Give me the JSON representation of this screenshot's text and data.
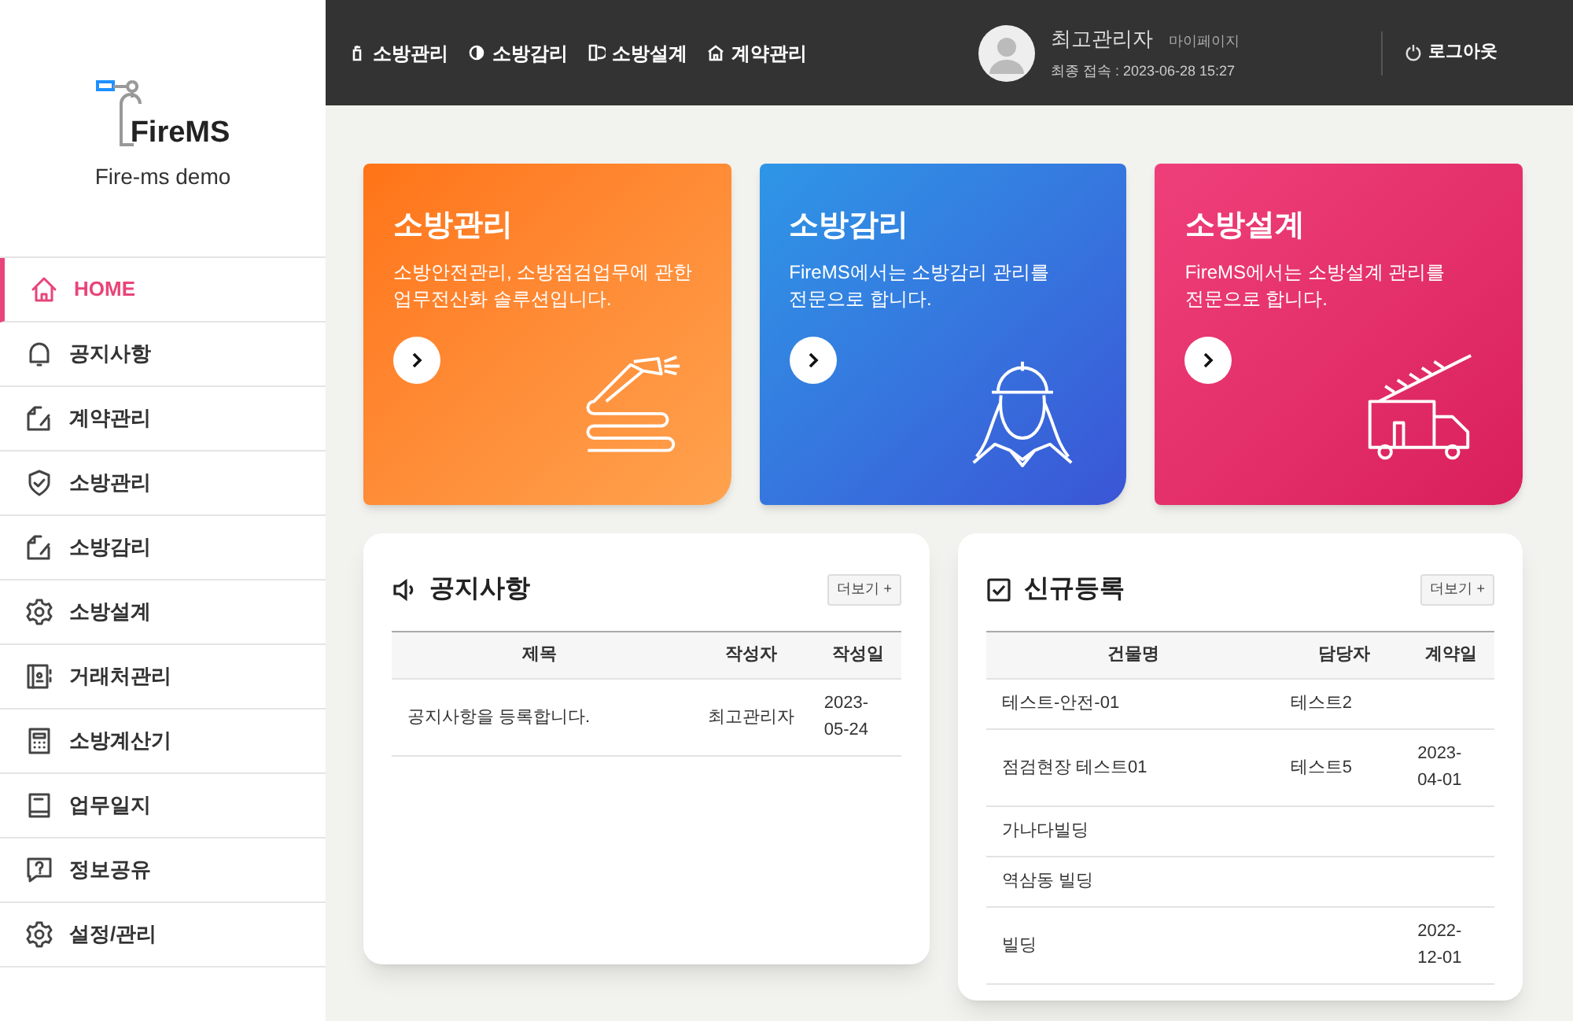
{
  "logo": {
    "name": "FireMS",
    "subtitle": "Fire-ms demo"
  },
  "sidebar": {
    "items": [
      {
        "label": "HOME",
        "kind": "home",
        "selected": true
      },
      {
        "label": "공지사항",
        "kind": "bell",
        "selected": false
      },
      {
        "label": "계약관리",
        "kind": "edit",
        "selected": false
      },
      {
        "label": "소방관리",
        "kind": "shield",
        "selected": false
      },
      {
        "label": "소방감리",
        "kind": "edit",
        "selected": false
      },
      {
        "label": "소방설계",
        "kind": "gear",
        "selected": false
      },
      {
        "label": "거래처관리",
        "kind": "contacts",
        "selected": false
      },
      {
        "label": "소방계산기",
        "kind": "calculator",
        "selected": false
      },
      {
        "label": "업무일지",
        "kind": "book",
        "selected": false
      },
      {
        "label": "정보공유",
        "kind": "question",
        "selected": false
      },
      {
        "label": "설정/관리",
        "kind": "gear",
        "selected": false
      }
    ]
  },
  "top_nav": [
    {
      "label": "소방관리",
      "kind": "extinguisher"
    },
    {
      "label": "소방감리",
      "kind": "contrast"
    },
    {
      "label": "소방설계",
      "kind": "design"
    },
    {
      "label": "계약관리",
      "kind": "contract"
    }
  ],
  "user": {
    "name": "최고관리자",
    "mypage": "마이페이지",
    "last_login": "최종 접속 : 2023-06-28 15:27",
    "logout": "로그아웃"
  },
  "cards": [
    {
      "title": "소방관리",
      "description": "소방안전관리, 소방점검업무에 관한\n업무전산화 솔루션입니다.",
      "kind": "hose"
    },
    {
      "title": "소방감리",
      "description": "FireMS에서는 소방감리 관리를\n전문으로 합니다.",
      "kind": "worker"
    },
    {
      "title": "소방설계",
      "description": "FireMS에서는 소방설계 관리를\n전문으로 합니다.",
      "kind": "truck"
    }
  ],
  "notice": {
    "title": "공지사항",
    "more": "더보기 +",
    "columns": [
      "제목",
      "작성자",
      "작성일"
    ],
    "rows": [
      [
        "공지사항을 등록합니다.",
        "최고관리자",
        "2023-\n05-24"
      ]
    ]
  },
  "new_registrations": {
    "title": "신규등록",
    "more": "더보기 +",
    "columns": [
      "건물명",
      "담당자",
      "계약일"
    ],
    "rows": [
      [
        "테스트-안전-01",
        "테스트2",
        ""
      ],
      [
        "점검현장 테스트01",
        "테스트5",
        "2023-\n04-01"
      ],
      [
        "가나다빌딩",
        "",
        ""
      ],
      [
        "역삼동 빌딩",
        "",
        ""
      ],
      [
        "빌딩",
        "",
        "2022-\n12-01"
      ]
    ]
  }
}
